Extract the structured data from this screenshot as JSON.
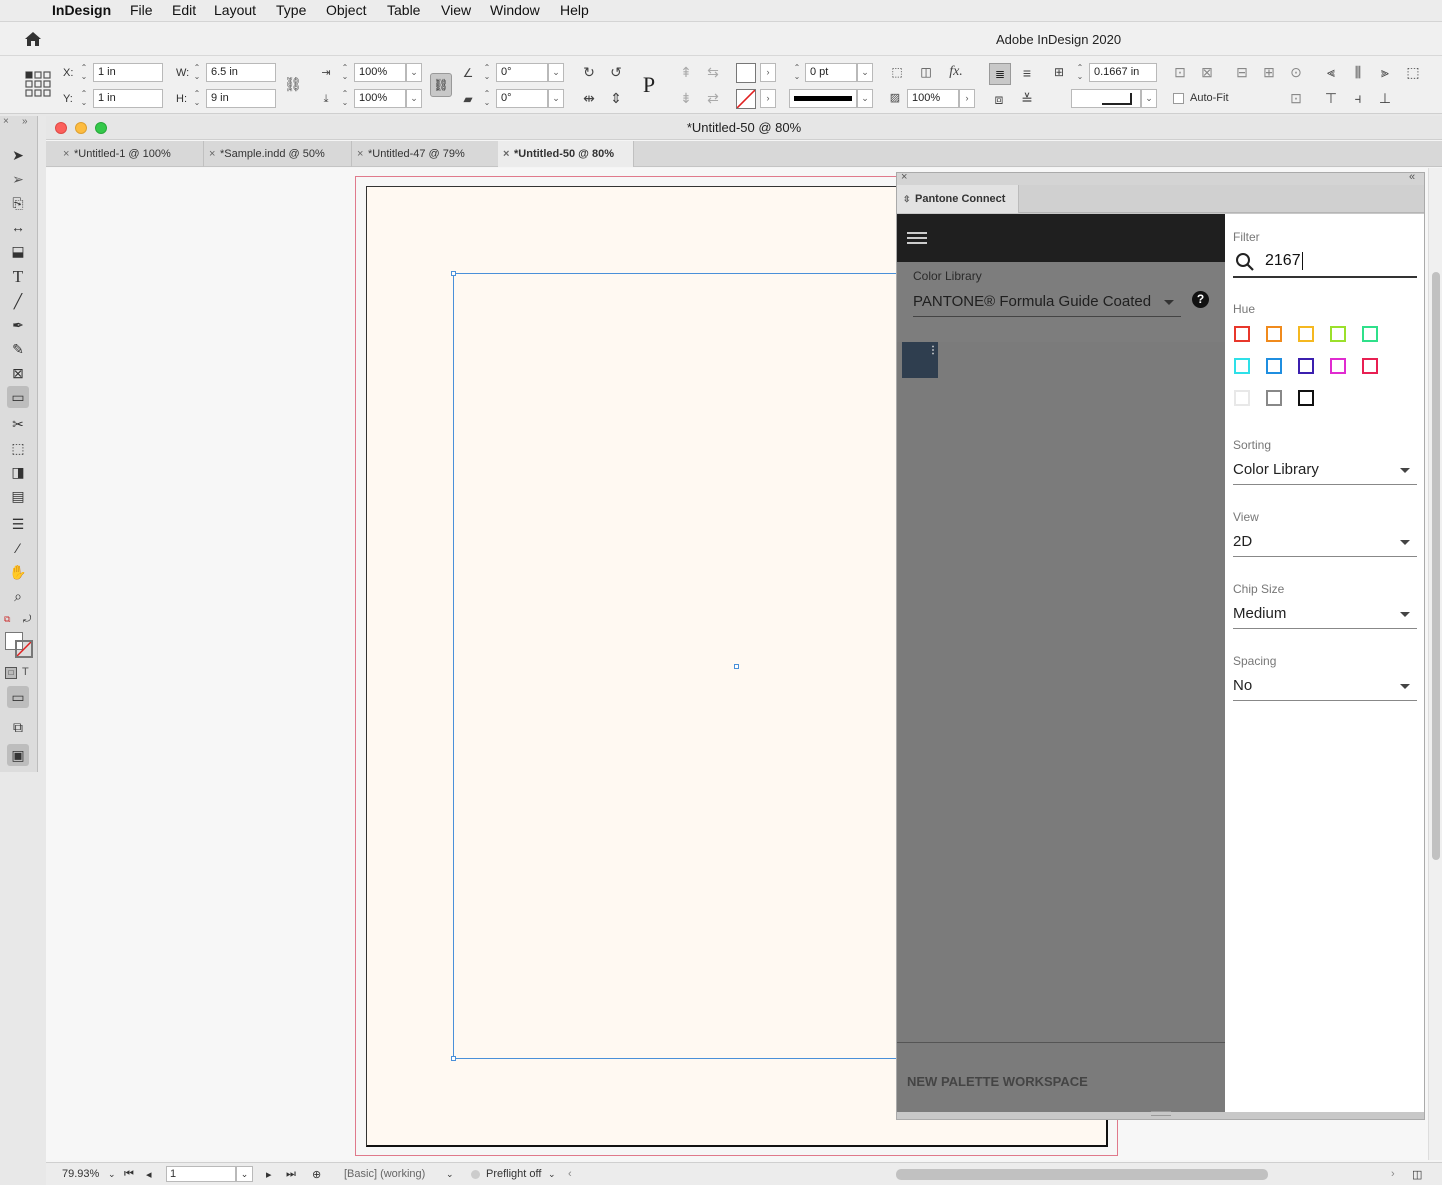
{
  "menubar": {
    "apple": "",
    "app_name": "InDesign",
    "items": [
      "File",
      "Edit",
      "Layout",
      "Type",
      "Object",
      "Table",
      "View",
      "Window",
      "Help"
    ]
  },
  "appbar": {
    "title": "Adobe InDesign 2020"
  },
  "controlbar": {
    "x_label": "X:",
    "x_value": "1 in",
    "y_label": "Y:",
    "y_value": "1 in",
    "w_label": "W:",
    "w_value": "6.5 in",
    "h_label": "H:",
    "h_value": "9 in",
    "scale_x": "100%",
    "scale_y": "100%",
    "rotate": "0°",
    "shear": "0°",
    "stroke_weight": "0 pt",
    "opacity": "100%",
    "gutter": "0.1667 in",
    "autofit_label": "Auto-Fit"
  },
  "document": {
    "window_title": "*Untitled-50 @ 80%",
    "tabs": [
      {
        "label": "*Untitled-1 @ 100%",
        "active": false
      },
      {
        "label": "*Sample.indd @ 50%",
        "active": false
      },
      {
        "label": "*Untitled-47 @ 79%",
        "active": false
      },
      {
        "label": "*Untitled-50 @ 80%",
        "active": true
      }
    ]
  },
  "statusbar": {
    "zoom": "79.93%",
    "page": "1",
    "profile": "[Basic] (working)",
    "preflight": "Preflight off"
  },
  "pantone": {
    "tab_label": "Pantone Connect",
    "color_library_label": "Color Library",
    "color_library_value": "PANTONE® Formula Guide Coated",
    "help_icon": "?",
    "workspace_label": "NEW PALETTE WORKSPACE",
    "filter_label": "Filter",
    "filter_value": "2167",
    "hue_label": "Hue",
    "hue_colors": [
      "#e8372b",
      "#f08a1c",
      "#f5b820",
      "#9be02b",
      "#2fe08a",
      "#2ee0e8",
      "#1f8ee0",
      "#3b1fae",
      "#e02bd0",
      "#e81f52",
      "#e8e8e8",
      "#888888",
      "#111111"
    ],
    "sorting_label": "Sorting",
    "sorting_value": "Color Library",
    "view_label": "View",
    "view_value": "2D",
    "chip_size_label": "Chip Size",
    "chip_size_value": "Medium",
    "spacing_label": "Spacing",
    "spacing_value": "No",
    "chip_color": "#2f3e4f"
  }
}
